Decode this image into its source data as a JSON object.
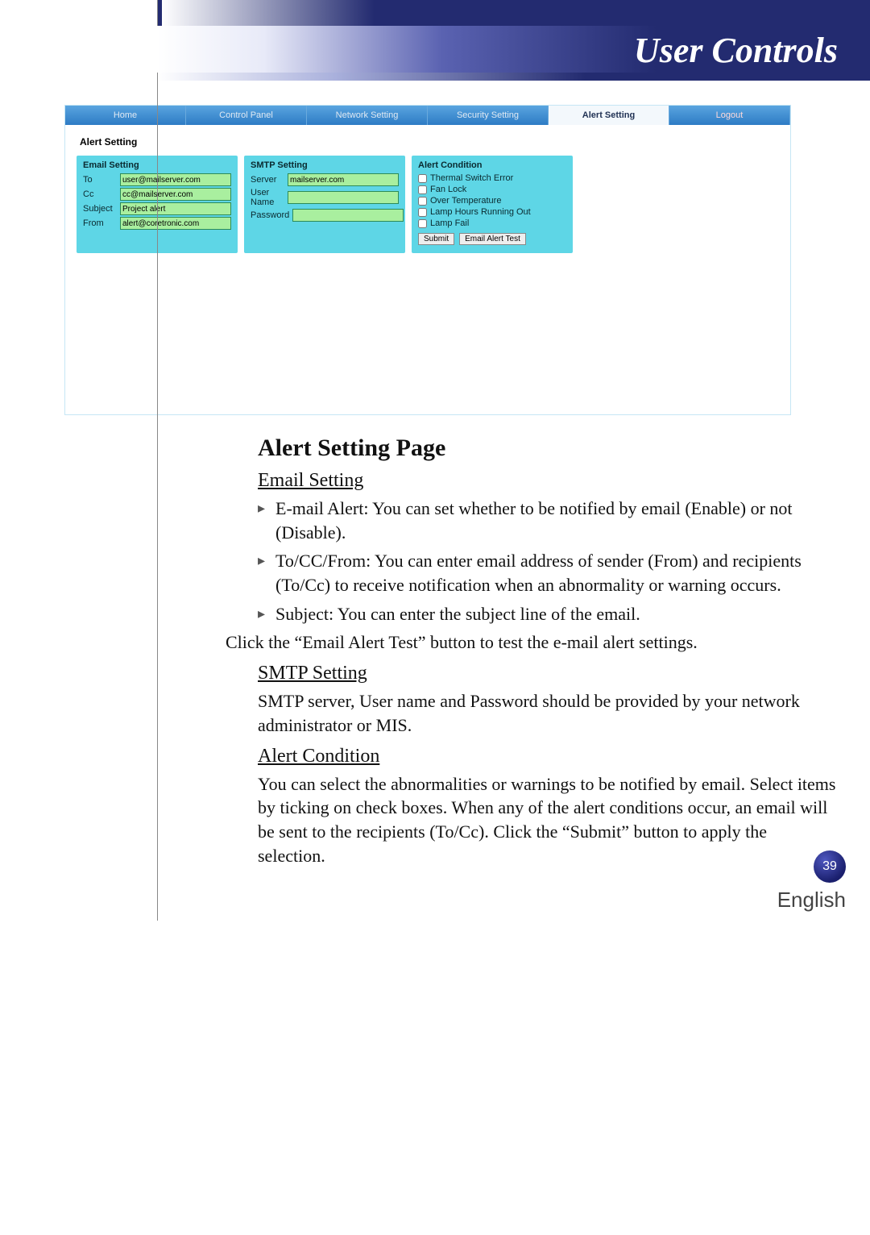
{
  "banner": {
    "title": "User Controls"
  },
  "screenshot": {
    "nav": {
      "home": "Home",
      "control_panel": "Control Panel",
      "network_setting": "Network Setting",
      "security_setting": "Security Setting",
      "alert_setting": "Alert Setting",
      "logout": "Logout"
    },
    "heading": "Alert Setting",
    "email_setting": {
      "title": "Email Setting",
      "to_label": "To",
      "to_value": "user@mailserver.com",
      "cc_label": "Cc",
      "cc_value": "cc@mailserver.com",
      "subject_label": "Subject",
      "subject_value": "Project alert",
      "from_label": "From",
      "from_value": "alert@coretronic.com"
    },
    "smtp_setting": {
      "title": "SMTP Setting",
      "server_label": "Server",
      "server_value": "mailserver.com",
      "username_label": "User Name",
      "username_value": "",
      "password_label": "Password",
      "password_value": ""
    },
    "alert_condition": {
      "title": "Alert Condition",
      "c1": "Thermal Switch Error",
      "c2": "Fan Lock",
      "c3": "Over Temperature",
      "c4": "Lamp Hours Running Out",
      "c5": "Lamp Fail",
      "submit": "Submit",
      "test": "Email Alert Test"
    }
  },
  "article": {
    "page_title": "Alert Setting Page",
    "email_heading": "Email Setting",
    "email_b1": "E-mail Alert: You can set whether to be notified by email (Enable) or not (Disable).",
    "email_b2": "To/CC/From: You can enter email address of sender (From) and recipients (To/Cc) to receive notification when an abnormality or warning occurs.",
    "email_b3": "Subject: You can enter the subject line of the email.",
    "email_note": "Click the “Email Alert Test” button to test the e-mail alert settings.",
    "smtp_heading": "SMTP Setting",
    "smtp_p": "SMTP server, User name and Password should be provided by your network administrator or MIS.",
    "cond_heading": "Alert Condition",
    "cond_p": "You can select the abnormalities or warnings to be notified by email. Select items by ticking on check boxes. When any of the alert conditions occur, an email will be sent to the recipients (To/Cc). Click the “Submit” button to apply the selection."
  },
  "footer": {
    "page_number": "39",
    "language": "English"
  }
}
